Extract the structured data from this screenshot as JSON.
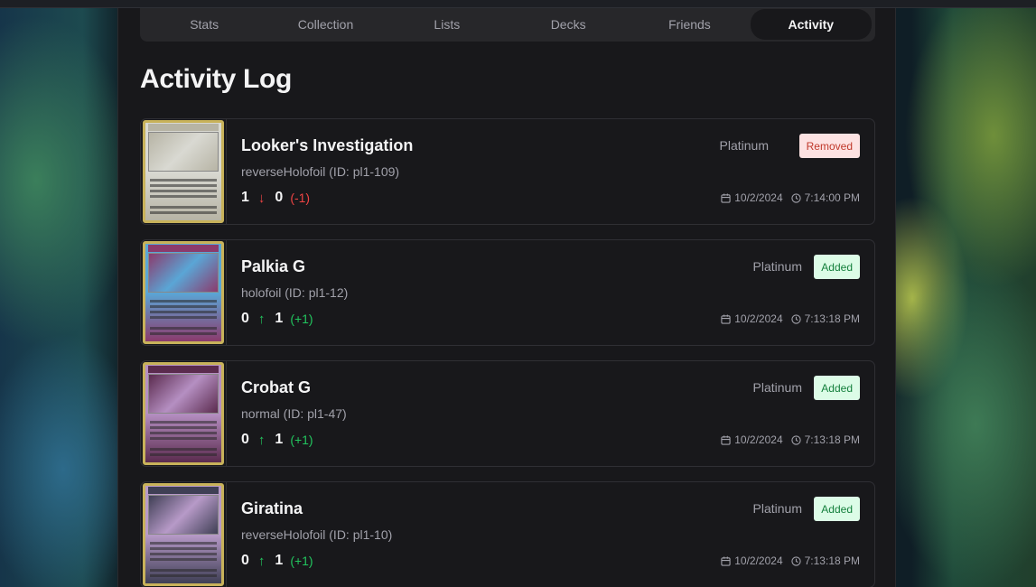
{
  "tabs": [
    {
      "label": "Stats",
      "active": false
    },
    {
      "label": "Collection",
      "active": false
    },
    {
      "label": "Lists",
      "active": false
    },
    {
      "label": "Decks",
      "active": false
    },
    {
      "label": "Friends",
      "active": false
    },
    {
      "label": "Activity",
      "active": true
    }
  ],
  "page_title": "Activity Log",
  "entries": [
    {
      "name": "Looker's Investigation",
      "variant": "reverseHolofoil (ID: pl1-109)",
      "from": "1",
      "to": "0",
      "diff": "(-1)",
      "direction": "down",
      "direction_icon": "arrow-down-icon",
      "set": "Platinum",
      "status": "Removed",
      "date": "10/2/2024",
      "time": "7:14:00 PM",
      "card_colors": [
        "#d9d9d2",
        "#b7b4a5"
      ]
    },
    {
      "name": "Palkia G",
      "variant": "holofoil (ID: pl1-12)",
      "from": "0",
      "to": "1",
      "diff": "(+1)",
      "direction": "up",
      "direction_icon": "arrow-up-icon",
      "set": "Platinum",
      "status": "Added",
      "date": "10/2/2024",
      "time": "7:13:18 PM",
      "card_colors": [
        "#5aa6d6",
        "#8b3b6d"
      ]
    },
    {
      "name": "Crobat G",
      "variant": "normal (ID: pl1-47)",
      "from": "0",
      "to": "1",
      "diff": "(+1)",
      "direction": "up",
      "direction_icon": "arrow-up-icon",
      "set": "Platinum",
      "status": "Added",
      "date": "10/2/2024",
      "time": "7:13:18 PM",
      "card_colors": [
        "#b58fc2",
        "#5b2b4e"
      ]
    },
    {
      "name": "Giratina",
      "variant": "reverseHolofoil (ID: pl1-10)",
      "from": "0",
      "to": "1",
      "diff": "(+1)",
      "direction": "up",
      "direction_icon": "arrow-up-icon",
      "set": "Platinum",
      "status": "Added",
      "date": "10/2/2024",
      "time": "7:13:18 PM",
      "card_colors": [
        "#b79ac8",
        "#3f3f55"
      ]
    }
  ],
  "icons": {
    "calendar": "calendar-icon",
    "clock": "clock-icon"
  },
  "colors": {
    "removed": "#ef4444",
    "added": "#22c55e",
    "panel": "#18181b"
  }
}
